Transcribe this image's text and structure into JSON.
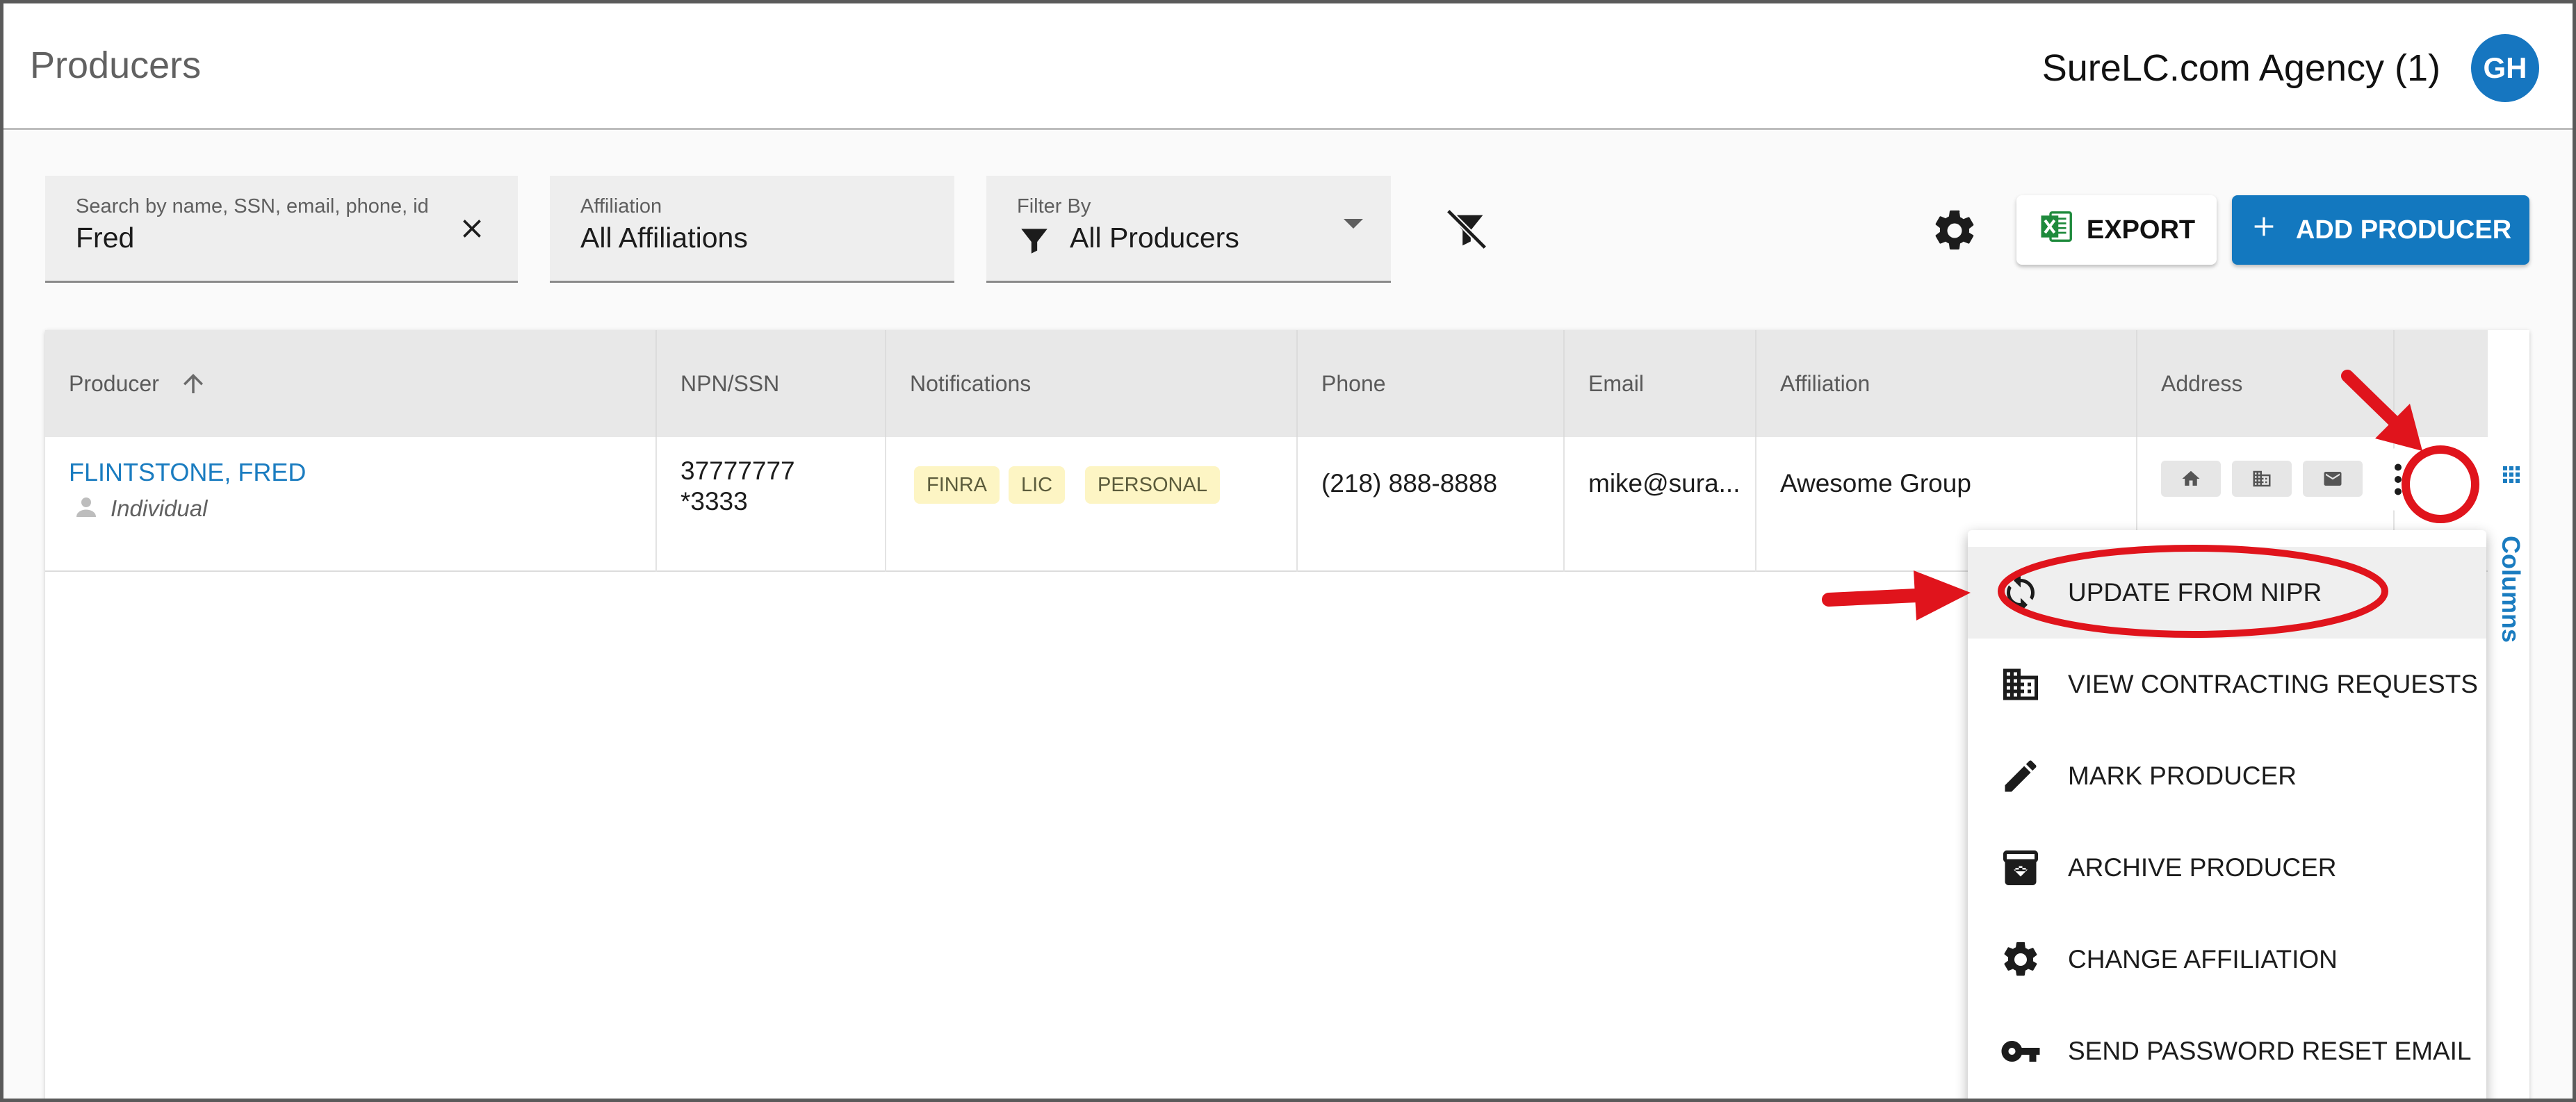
{
  "header": {
    "title": "Producers",
    "agency": "SureLC.com Agency (1)",
    "avatar_initials": "GH"
  },
  "filters": {
    "search": {
      "label": "Search by name, SSN, email, phone, id",
      "value": "Fred"
    },
    "affiliation": {
      "label": "Affiliation",
      "value": "All Affiliations"
    },
    "filter_by": {
      "label": "Filter By",
      "value": "All Producers"
    }
  },
  "toolbar": {
    "export_label": "EXPORT",
    "add_label": "ADD PRODUCER"
  },
  "table": {
    "columns": [
      "Producer",
      "NPN/SSN",
      "Notifications",
      "Phone",
      "Email",
      "Affiliation",
      "Address"
    ],
    "rows": [
      {
        "producer": "FLINTSTONE, FRED",
        "type": "Individual",
        "npn": "37777777",
        "ssn": "*3333",
        "notifications": [
          "FINRA",
          "LIC",
          "PERSONAL"
        ],
        "phone": "(218) 888-8888",
        "email": "mike@sura...",
        "affiliation": "Awesome Group"
      }
    ],
    "columns_tab": "Columns"
  },
  "menu": {
    "items": [
      {
        "label": "UPDATE FROM NIPR",
        "icon": "sync-icon"
      },
      {
        "label": "VIEW CONTRACTING REQUESTS",
        "icon": "building-icon"
      },
      {
        "label": "MARK PRODUCER",
        "icon": "pencil-icon"
      },
      {
        "label": "ARCHIVE PRODUCER",
        "icon": "archive-icon"
      },
      {
        "label": "CHANGE AFFILIATION",
        "icon": "gear-icon"
      },
      {
        "label": "SEND PASSWORD RESET EMAIL",
        "icon": "key-icon"
      }
    ]
  },
  "colors": {
    "primary": "#1378bf",
    "link": "#1a7cc0",
    "badge_bg": "#fdf5c4",
    "annotation_red": "#e0141c"
  }
}
